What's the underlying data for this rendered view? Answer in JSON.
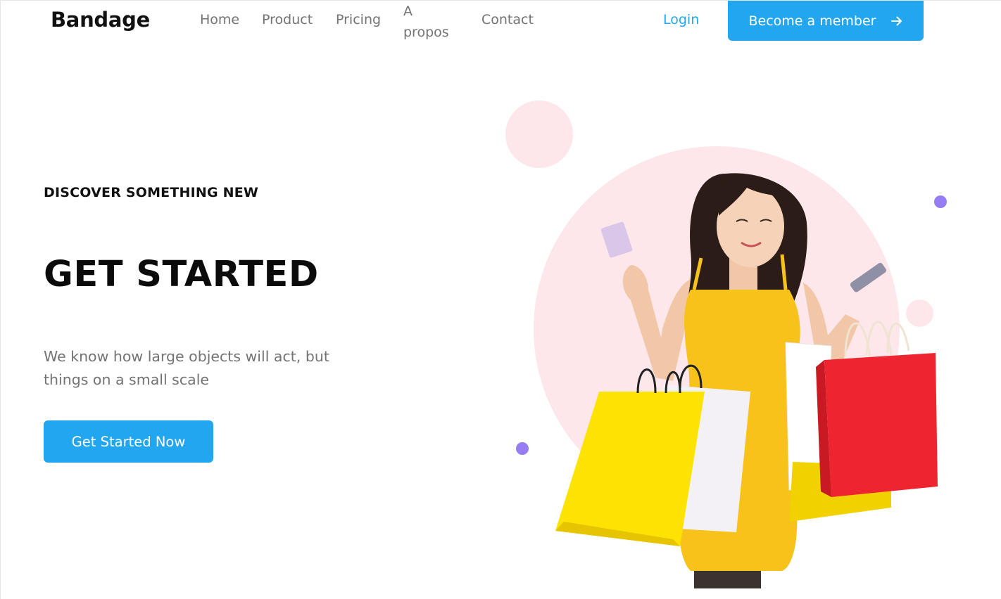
{
  "header": {
    "brand": "Bandage",
    "nav": {
      "home": "Home",
      "product": "Product",
      "pricing": "Pricing",
      "apropos": "A propos",
      "contact": "Contact"
    },
    "login": "Login",
    "member_button": "Become a member",
    "member_icon": "arrow-right-icon"
  },
  "hero": {
    "eyebrow": "DISCOVER SOMETHING NEW",
    "title": "GET STARTED",
    "description": "We know how large objects will act, but things on a small scale",
    "cta": "Get Started Now"
  },
  "colors": {
    "primary": "#23a6f0",
    "pink": "#fde7ea",
    "purple": "#977df4",
    "text_dark": "#111111",
    "text_muted": "#737373"
  }
}
